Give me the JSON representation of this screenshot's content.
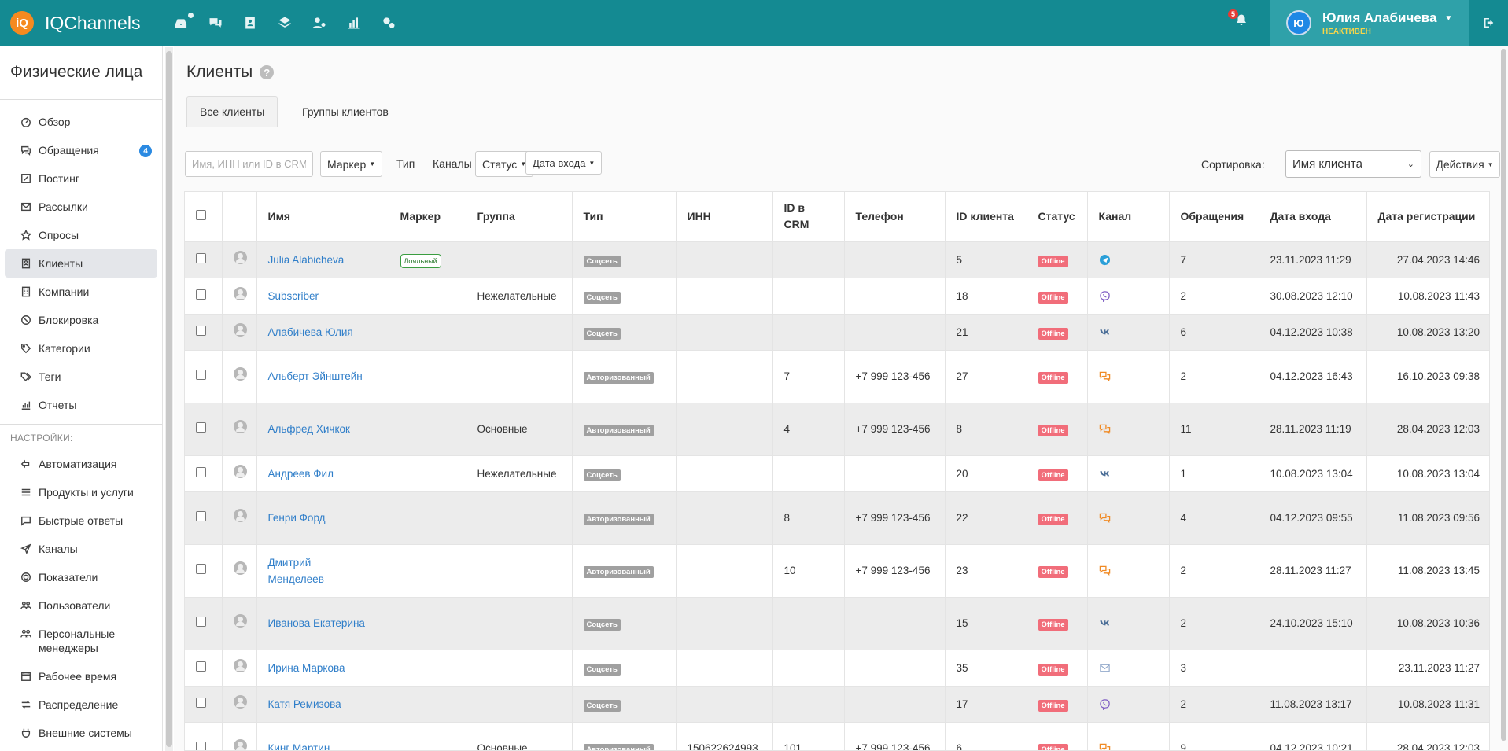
{
  "app": {
    "name": "IQChannels",
    "logo_text": "iQ",
    "notifications_count": "5",
    "user_initial": "Ю",
    "user_name": "Юлия Алабичева",
    "user_status": "НЕАКТИВЕН"
  },
  "sidebar": {
    "title": "Физические лица",
    "items": [
      {
        "label": "Обзор",
        "icon": "gauge-icon"
      },
      {
        "label": "Обращения",
        "icon": "chat-icon",
        "badge": "4"
      },
      {
        "label": "Постинг",
        "icon": "edit-icon"
      },
      {
        "label": "Рассылки",
        "icon": "mail-icon"
      },
      {
        "label": "Опросы",
        "icon": "star-icon"
      },
      {
        "label": "Клиенты",
        "icon": "contact-icon",
        "active": true
      },
      {
        "label": "Компании",
        "icon": "building-icon"
      },
      {
        "label": "Блокировка",
        "icon": "block-icon"
      },
      {
        "label": "Категории",
        "icon": "tag-icon"
      },
      {
        "label": "Теги",
        "icon": "tags-icon"
      },
      {
        "label": "Отчеты",
        "icon": "chart-icon"
      }
    ],
    "settings_label": "НАСТРОЙКИ:",
    "settings_items": [
      {
        "label": "Автоматизация",
        "icon": "automation-icon"
      },
      {
        "label": "Продукты и услуги",
        "icon": "list-icon"
      },
      {
        "label": "Быстрые ответы",
        "icon": "quick-reply-icon"
      },
      {
        "label": "Каналы",
        "icon": "send-icon"
      },
      {
        "label": "Показатели",
        "icon": "target-icon"
      },
      {
        "label": "Пользователи",
        "icon": "users-icon"
      },
      {
        "label": "Персональные менеджеры",
        "icon": "managers-icon"
      },
      {
        "label": "Рабочее время",
        "icon": "calendar-icon"
      },
      {
        "label": "Распределение",
        "icon": "distribution-icon"
      },
      {
        "label": "Внешние системы",
        "icon": "plug-icon"
      }
    ]
  },
  "page": {
    "title": "Клиенты",
    "help": "?",
    "tabs": [
      "Все клиенты",
      "Группы клиентов"
    ]
  },
  "filters": {
    "search_placeholder": "Имя, ИНН или ID в CRM",
    "marker": "Маркер",
    "type": "Тип",
    "channels": "Каналы",
    "status": "Статус",
    "login_date": "Дата входа",
    "sort_label": "Сортировка:",
    "sort_value": "Имя клиента",
    "actions": "Действия"
  },
  "table": {
    "headers": [
      "Имя",
      "Маркер",
      "Группа",
      "Тип",
      "ИНН",
      "ID в CRM",
      "Телефон",
      "ID клиента",
      "Статус",
      "Канал",
      "Обращения",
      "Дата входа",
      "Дата регистрации"
    ],
    "rows": [
      {
        "name": "Julia Alabicheva",
        "marker": "Лояльный",
        "group": "",
        "type": "Соцсеть",
        "inn": "",
        "crm": "",
        "phone": "",
        "cid": "5",
        "status": "Offline",
        "channel": "telegram",
        "requests": "7",
        "login": "23.11.2023 11:29",
        "reg": "27.04.2023 14:46"
      },
      {
        "name": "Subscriber",
        "marker": "",
        "group": "Нежелательные",
        "type": "Соцсеть",
        "inn": "",
        "crm": "",
        "phone": "",
        "cid": "18",
        "status": "Offline",
        "channel": "viber",
        "requests": "2",
        "login": "30.08.2023 12:10",
        "reg": "10.08.2023 11:43"
      },
      {
        "name": "Алабичева Юлия",
        "marker": "",
        "group": "",
        "type": "Соцсеть",
        "inn": "",
        "crm": "",
        "phone": "",
        "cid": "21",
        "status": "Offline",
        "channel": "vk",
        "requests": "6",
        "login": "04.12.2023 10:38",
        "reg": "10.08.2023 13:20"
      },
      {
        "name": "Альберт Эйнштейн",
        "marker": "",
        "group": "",
        "type": "Авторизованный",
        "inn": "",
        "crm": "7",
        "phone": "+7 999 123-456",
        "cid": "27",
        "status": "Offline",
        "channel": "chat",
        "requests": "2",
        "login": "04.12.2023 16:43",
        "reg": "16.10.2023 09:38"
      },
      {
        "name": "Альфред Хичкок",
        "marker": "",
        "group": "Основные",
        "type": "Авторизованный",
        "inn": "",
        "crm": "4",
        "phone": "+7 999 123-456",
        "cid": "8",
        "status": "Offline",
        "channel": "chat",
        "requests": "11",
        "login": "28.11.2023 11:19",
        "reg": "28.04.2023 12:03"
      },
      {
        "name": "Андреев Фил",
        "marker": "",
        "group": "Нежелательные",
        "type": "Соцсеть",
        "inn": "",
        "crm": "",
        "phone": "",
        "cid": "20",
        "status": "Offline",
        "channel": "vk",
        "requests": "1",
        "login": "10.08.2023 13:04",
        "reg": "10.08.2023 13:04"
      },
      {
        "name": "Генри Форд",
        "marker": "",
        "group": "",
        "type": "Авторизованный",
        "inn": "",
        "crm": "8",
        "phone": "+7 999 123-456",
        "cid": "22",
        "status": "Offline",
        "channel": "chat",
        "requests": "4",
        "login": "04.12.2023 09:55",
        "reg": "11.08.2023 09:56"
      },
      {
        "name": "Дмитрий Менделеев",
        "marker": "",
        "group": "",
        "type": "Авторизованный",
        "inn": "",
        "crm": "10",
        "phone": "+7 999 123-456",
        "cid": "23",
        "status": "Offline",
        "channel": "chat",
        "requests": "2",
        "login": "28.11.2023 11:27",
        "reg": "11.08.2023 13:45"
      },
      {
        "name": "Иванова Екатерина",
        "marker": "",
        "group": "",
        "type": "Соцсеть",
        "inn": "",
        "crm": "",
        "phone": "",
        "cid": "15",
        "status": "Offline",
        "channel": "vk",
        "requests": "2",
        "login": "24.10.2023 15:10",
        "reg": "10.08.2023 10:36"
      },
      {
        "name": "Ирина Маркова",
        "marker": "",
        "group": "",
        "type": "Соцсеть",
        "inn": "",
        "crm": "",
        "phone": "",
        "cid": "35",
        "status": "Offline",
        "channel": "email",
        "requests": "3",
        "login": "",
        "reg": "23.11.2023 11:27"
      },
      {
        "name": "Катя Ремизова",
        "marker": "",
        "group": "",
        "type": "Соцсеть",
        "inn": "",
        "crm": "",
        "phone": "",
        "cid": "17",
        "status": "Offline",
        "channel": "viber",
        "requests": "2",
        "login": "11.08.2023 13:17",
        "reg": "10.08.2023 11:31"
      },
      {
        "name": "Кинг Мартин",
        "marker": "",
        "group": "Основные",
        "type": "Авторизованный",
        "inn": "150622624993",
        "crm": "101",
        "phone": "+7 999 123-456",
        "cid": "6",
        "status": "Offline",
        "channel": "chat",
        "requests": "9",
        "login": "04.12.2023 10:21",
        "reg": "28.04.2023 12:03"
      }
    ]
  },
  "colors": {
    "topbar": "#148a92",
    "user_panel": "#2fa1a9",
    "link": "#2f7ec9",
    "status_offline": "#f16d7a",
    "type_tag": "#a0a0a0",
    "marker_loyal": "#3a9d40"
  }
}
